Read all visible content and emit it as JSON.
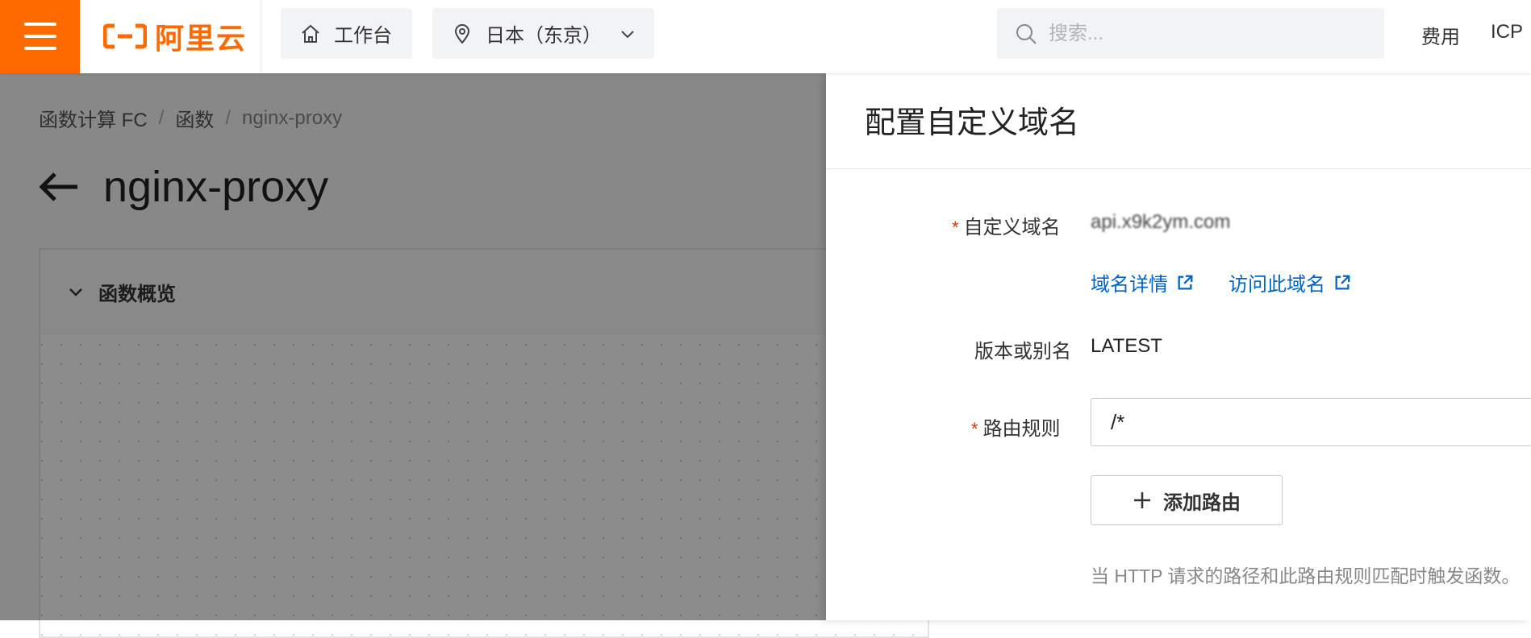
{
  "topbar": {
    "logo_text": "阿里云",
    "workbench_label": "工作台",
    "region_label": "日本（东京）",
    "search_placeholder": "搜索...",
    "links": [
      "费用",
      "ICP"
    ]
  },
  "page": {
    "breadcrumb": [
      "函数计算 FC",
      "函数",
      "nginx-proxy"
    ],
    "title": "nginx-proxy",
    "panel_title": "函数概览"
  },
  "drawer": {
    "title": "配置自定义域名",
    "domain_label": "自定义域名",
    "domain_value": "api.x9k2ym.com",
    "domain_details_link": "域名详情",
    "visit_domain_link": "访问此域名",
    "version_label": "版本或别名",
    "version_value": "LATEST",
    "route_label": "路由规则",
    "route_value": "/*",
    "add_route_button": "添加路由",
    "route_hint": "当 HTTP 请求的路径和此路由规则匹配时触发函数。"
  },
  "colors": {
    "brand": "#ff6a00",
    "link": "#0064c8",
    "required": "#d4380d"
  }
}
